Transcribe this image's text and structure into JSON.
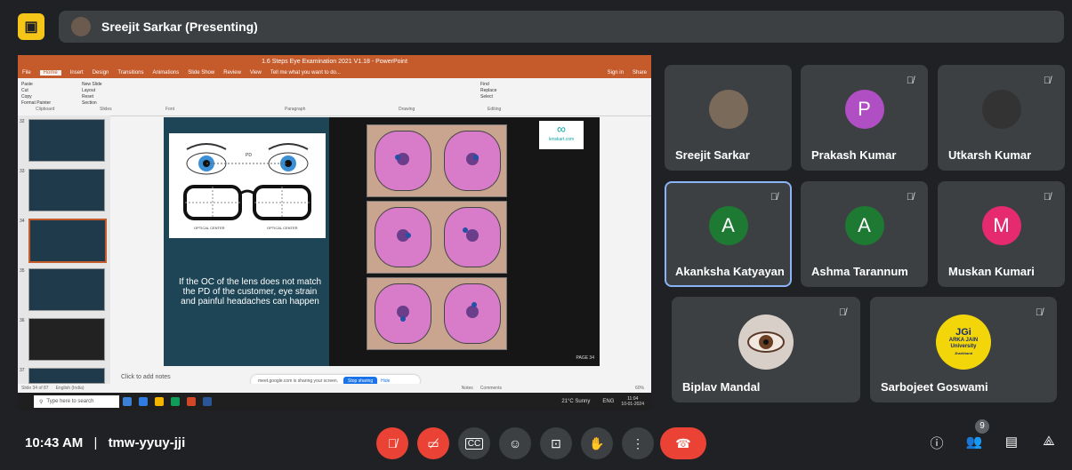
{
  "presenter": {
    "label": "Sreejit Sarkar (Presenting)"
  },
  "powerpoint": {
    "title": "1.6 Steps Eye Examination 2021 V1.18 - PowerPoint",
    "tell_me": "Tell me what you want to do...",
    "sign_in": "Sign in",
    "share": "Share",
    "tabs": [
      "File",
      "Home",
      "Insert",
      "Design",
      "Transitions",
      "Animations",
      "Slide Show",
      "Review",
      "View"
    ],
    "ribbon_groups": [
      "Clipboard",
      "Slides",
      "Font",
      "Paragraph",
      "Drawing",
      "Editing"
    ],
    "ribbon_buttons": {
      "paste": "Paste",
      "cut": "Cut",
      "copy": "Copy",
      "format_painter": "Format Painter",
      "new_slide": "New Slide",
      "layout": "Layout",
      "reset": "Reset",
      "section": "Section",
      "find": "Find",
      "replace": "Replace",
      "select": "Select"
    },
    "slide_numbers": [
      "32",
      "33",
      "34",
      "35",
      "36",
      "37"
    ],
    "slide": {
      "text": "If the OC of the lens does not match the PD of the customer, eye strain and painful headaches can happen",
      "pd_label": "PD",
      "optical_center_left": "OPTICAL CENTER",
      "optical_center_right": "OPTICAL CENTER",
      "logo": "lenskart.com",
      "page": "PAGE 34"
    },
    "notes": "Click to add notes",
    "status": {
      "slide_count": "Slide 34 of 87",
      "language": "English (India)",
      "notes": "Notes",
      "comments": "Comments",
      "zoom": "60%"
    },
    "share_pill": {
      "text": "meet.google.com is sharing your screen.",
      "stop": "Stop sharing",
      "hide": "Hide"
    },
    "taskbar": {
      "search": "Type here to search",
      "weather": "21°C Sunny",
      "lang": "ENG",
      "time": "11:04",
      "date": "10-01-2024"
    }
  },
  "participants": [
    {
      "name": "Sreejit Sarkar",
      "initial": "",
      "color": "#7a6a5a",
      "muted": false
    },
    {
      "name": "Prakash Kumar",
      "initial": "P",
      "color": "#b04fc4",
      "muted": true
    },
    {
      "name": "Utkarsh Kumar",
      "initial": "",
      "color": "#333333",
      "muted": true
    },
    {
      "name": "Akanksha Katyayan",
      "initial": "A",
      "color": "#1e7a32",
      "muted": true
    },
    {
      "name": "Ashma Tarannum",
      "initial": "A",
      "color": "#1e7a32",
      "muted": true
    },
    {
      "name": "Muskan Kumari",
      "initial": "M",
      "color": "#e52a6f",
      "muted": true
    },
    {
      "name": "Biplav Mandal",
      "initial": "",
      "color": "#d8d0c8",
      "muted": true
    },
    {
      "name": "Sarbojeet Goswami",
      "initial": "",
      "color": "#f2d60a",
      "muted": true
    }
  ],
  "jgi_logo": {
    "line1": "JGi",
    "line2": "ARKA JAIN",
    "line3": "University",
    "line4": "Jharkhand"
  },
  "meeting": {
    "time": "10:43 AM",
    "separator": "|",
    "code": "tmw-yyuy-jji"
  },
  "people_count": "9",
  "colors": {
    "bg": "#202124",
    "tile": "#3c4043",
    "red": "#ea4335",
    "accent": "#8ab4f8",
    "ppt": "#c55a2b"
  }
}
